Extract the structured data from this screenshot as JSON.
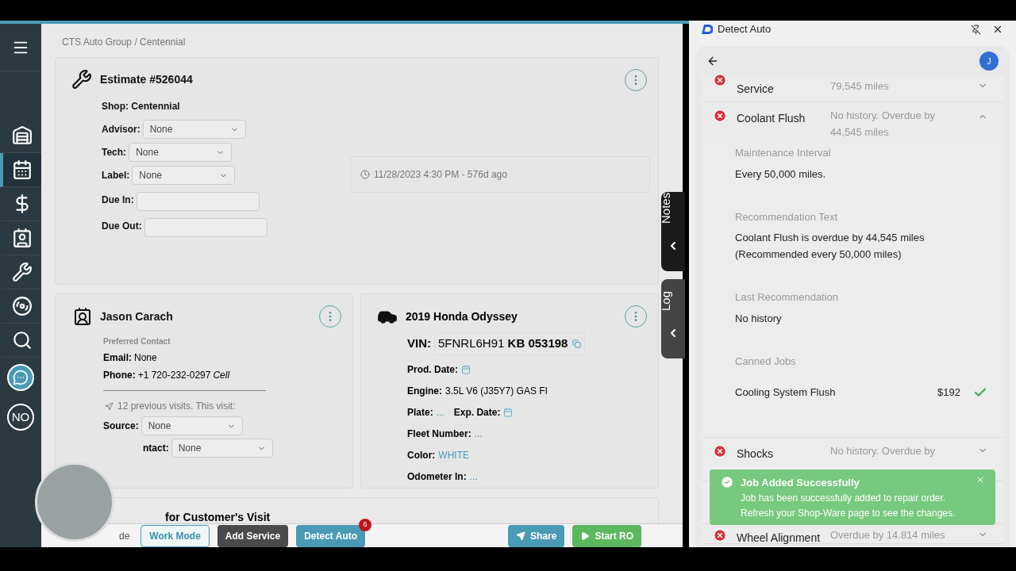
{
  "sidebar": {
    "items": [
      {
        "kind": "lift",
        "selected": false
      },
      {
        "kind": "calendar",
        "selected": true
      },
      {
        "kind": "dollar",
        "selected": false
      },
      {
        "kind": "contacts",
        "selected": false
      },
      {
        "kind": "parts",
        "selected": false
      },
      {
        "kind": "tire",
        "selected": false
      },
      {
        "kind": "search",
        "selected": false
      },
      {
        "kind": "chat",
        "selected": false
      },
      {
        "kind": "status",
        "label": "NO",
        "selected": false
      }
    ]
  },
  "breadcrumb": "CTS Auto Group / Centennial",
  "estimate": {
    "title": "Estimate #526044",
    "shop": "Shop: Centennial",
    "fields": [
      {
        "label": "Advisor:",
        "kind": "select",
        "value": "None"
      },
      {
        "label": "Tech:",
        "kind": "select",
        "value": "None"
      },
      {
        "label": "Label:",
        "kind": "select",
        "value": "None"
      },
      {
        "label": "Due In:",
        "kind": "input"
      },
      {
        "label": "Due Out:",
        "kind": "input"
      }
    ],
    "timestamp": "11/28/2023 4:30 PM - 576d ago"
  },
  "side_tabs": [
    "Notes",
    "Log"
  ],
  "customer": {
    "name": "Jason Carach",
    "preferred_label": "Preferred Contact",
    "email_label": "Email:",
    "email": "None",
    "phone_label": "Phone:",
    "phone": "+1 720-232-0297",
    "phone_type": "Cell",
    "visits": "12 previous visits. This visit:",
    "fields": [
      {
        "label": "Source:",
        "value": "None"
      },
      {
        "label": "ntact:",
        "value": "None"
      }
    ]
  },
  "vehicle": {
    "title": "2019 Honda Odyssey",
    "vin_label": "VIN:",
    "vin": "5FNRL6H91 **KB 053198**",
    "lines": [
      [
        {
          "label": "Prod. Date:",
          "kind": "date"
        }
      ],
      [
        {
          "label": "Engine:",
          "kind": "text",
          "value": "3.5L V6 (J35Y7) GAS FI"
        }
      ],
      [
        {
          "label": "Plate:",
          "kind": "link",
          "value": "..."
        },
        {
          "label": "Exp. Date:",
          "kind": "date"
        }
      ],
      [
        {
          "label": "Fleet Number:",
          "kind": "link",
          "value": "..."
        }
      ],
      [
        {
          "label": "Color:",
          "kind": "link",
          "value": "WHITE"
        }
      ],
      [
        {
          "label": "Odometer In:",
          "kind": "link",
          "value": "..."
        }
      ]
    ]
  },
  "visit_heading": "for Customer's Visit",
  "toolbar": {
    "partial_label": "de",
    "buttons": [
      {
        "label": "Work Mode",
        "kind": "outline"
      },
      {
        "label": "Add Service",
        "kind": "dark"
      },
      {
        "label": "Detect Auto",
        "kind": "teal",
        "badge": "6"
      },
      {
        "label": "Share",
        "kind": "share"
      },
      {
        "label": "Start RO",
        "kind": "start"
      }
    ]
  },
  "panel": {
    "title": "Detect Auto",
    "avatar": "J",
    "items": [
      {
        "name": "Service",
        "status": "79,545 miles",
        "expanded": false
      },
      {
        "name": "Coolant Flush",
        "status": "No history. Overdue by 44,545 miles",
        "expanded": true,
        "details": [
          {
            "label": "Maintenance Interval",
            "value": "Every 50,000 miles."
          },
          {
            "label": "Recommendation Text",
            "value": "Coolant Flush is overdue by 44,545 miles (Recommended every 50,000 miles)"
          },
          {
            "label": "Last Recommendation",
            "value": "No history"
          }
        ],
        "canned_label": "Canned Jobs",
        "canned_jobs": [
          {
            "name": "Cooling System Flush",
            "price": "$192",
            "added": true
          }
        ]
      },
      {
        "name": "Shocks",
        "status": "No history. Overdue by",
        "expanded": false
      },
      {
        "kind": "covered"
      },
      {
        "name": "Wheel Alignment",
        "status": "Overdue by 14.814 miles",
        "expanded": false
      }
    ],
    "toast": {
      "title": "Job Added Successfully",
      "message": "Job has been successfully added to repair order. Refresh your Shop-Ware page to see the changes."
    }
  }
}
